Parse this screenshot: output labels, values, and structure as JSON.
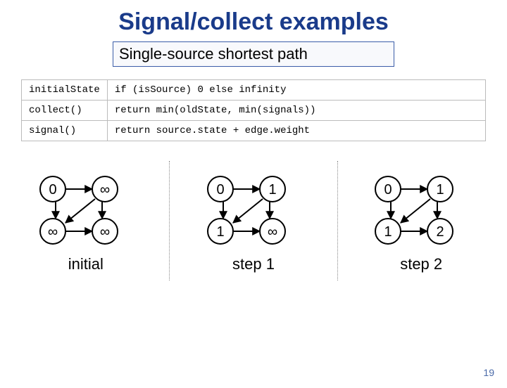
{
  "title": "Signal/collect examples",
  "subtitle": "Single-source shortest path",
  "table": {
    "r0": {
      "label": "initialState",
      "code": "if (isSource) 0 else infinity"
    },
    "r1": {
      "label": "collect()",
      "code": "return min(oldState, min(signals))"
    },
    "r2": {
      "label": "signal()",
      "code": "return source.state + edge.weight"
    }
  },
  "panels": [
    {
      "label": "initial",
      "nodes": {
        "tl": "0",
        "tr": "∞",
        "bl": "∞",
        "br": "∞"
      }
    },
    {
      "label": "step 1",
      "nodes": {
        "tl": "0",
        "tr": "1",
        "bl": "1",
        "br": "∞"
      }
    },
    {
      "label": "step 2",
      "nodes": {
        "tl": "0",
        "tr": "1",
        "bl": "1",
        "br": "2"
      }
    }
  ],
  "page_number": "19",
  "chart_data": {
    "type": "table",
    "description": "Single-source shortest-path propagation over a 4-node graph with unit-weight edges",
    "node_ids": [
      "tl",
      "tr",
      "bl",
      "br"
    ],
    "edges": [
      [
        "tl",
        "tr",
        1
      ],
      [
        "tl",
        "bl",
        1
      ],
      [
        "tr",
        "br",
        1
      ],
      [
        "bl",
        "br",
        1
      ],
      [
        "tr",
        "bl",
        1
      ]
    ],
    "steps": [
      {
        "name": "initial",
        "values": {
          "tl": 0,
          "tr": "inf",
          "bl": "inf",
          "br": "inf"
        }
      },
      {
        "name": "step 1",
        "values": {
          "tl": 0,
          "tr": 1,
          "bl": 1,
          "br": "inf"
        }
      },
      {
        "name": "step 2",
        "values": {
          "tl": 0,
          "tr": 1,
          "bl": 1,
          "br": 2
        }
      }
    ]
  }
}
